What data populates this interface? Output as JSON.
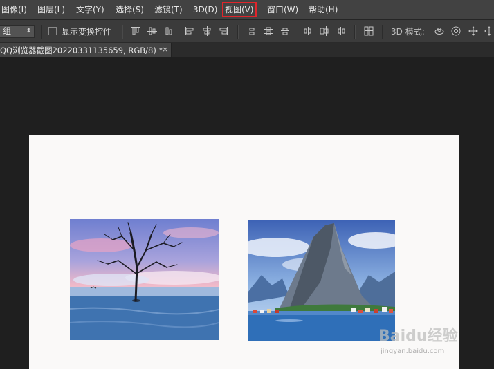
{
  "menubar": {
    "items": [
      {
        "label": "图像(I)"
      },
      {
        "label": "图层(L)"
      },
      {
        "label": "文字(Y)"
      },
      {
        "label": "选择(S)"
      },
      {
        "label": "滤镜(T)"
      },
      {
        "label": "3D(D)"
      },
      {
        "label": "视图(V)",
        "highlighted": true
      },
      {
        "label": "窗口(W)"
      },
      {
        "label": "帮助(H)"
      }
    ],
    "highlight_color": "#e0252b"
  },
  "options": {
    "select_value": "组",
    "show_transform_controls_label": "显示变换控件",
    "show_transform_controls_checked": false,
    "mode_label": "3D 模式:",
    "align_icons": [
      "align-top-edges-icon",
      "align-vertical-centers-icon",
      "align-bottom-edges-icon",
      "align-left-edges-icon",
      "align-horizontal-centers-icon",
      "align-right-edges-icon"
    ],
    "distribute_icons": [
      "distribute-top-icon",
      "distribute-vcenter-icon",
      "distribute-bottom-icon",
      "distribute-left-icon",
      "distribute-hcenter-icon",
      "distribute-right-icon"
    ],
    "auto_align_icon": "auto-align-layers-icon",
    "mode_icons": [
      "rotate-3d-icon",
      "roll-3d-icon",
      "drag-3d-icon",
      "slide-3d-icon"
    ]
  },
  "document_tab": {
    "title": "QQ浏览器截图20220331135659, RGB/8) *",
    "close": "×"
  },
  "watermark": {
    "brand": "Baidu经验",
    "url": "jingyan.baidu.com"
  }
}
